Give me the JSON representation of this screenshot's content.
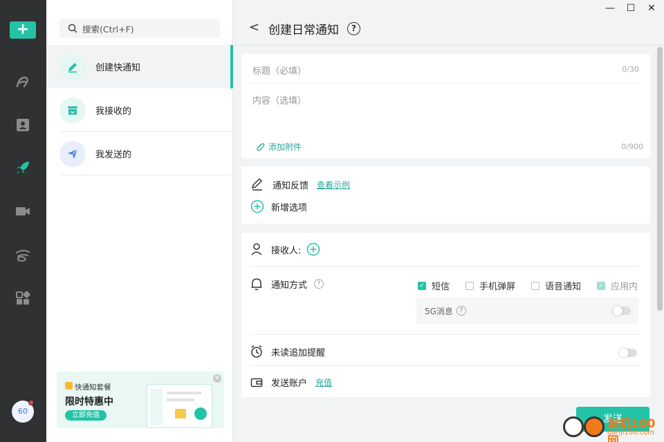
{
  "rail": {
    "new_label": "+",
    "icons": [
      "logo-a-icon",
      "contacts-icon",
      "rocket-icon",
      "video-icon",
      "cloud-icon",
      "apps-icon"
    ],
    "avatar": "60"
  },
  "search": {
    "placeholder": "搜索(Ctrl+F)"
  },
  "nav": [
    {
      "label": "创建快通知"
    },
    {
      "label": "我接收的"
    },
    {
      "label": "我发送的"
    }
  ],
  "promo": {
    "tag": "快通知套餐",
    "headline": "限时特惠中",
    "button": "立即充值"
  },
  "header": {
    "back": "<",
    "title": "创建日常通知",
    "help": "?"
  },
  "window": {
    "minimize": "—",
    "maximize": "☐",
    "close": "✕"
  },
  "form": {
    "title_placeholder": "标题（必填）",
    "title_count": "0/30",
    "content_placeholder": "内容（选填）",
    "content_count": "0/900",
    "attach_label": "添加附件"
  },
  "feedback": {
    "label": "通知反馈",
    "example_link": "查看示例",
    "add_option": "新增选项"
  },
  "recipients": {
    "label": "接收人:"
  },
  "method": {
    "label": "通知方式",
    "options": [
      {
        "label": "短信",
        "checked": true
      },
      {
        "label": "手机弹屏",
        "checked": false
      },
      {
        "label": "语音通知",
        "checked": false
      },
      {
        "label": "应用内",
        "checked": true
      }
    ],
    "sub_label": "5G消息"
  },
  "reminder": {
    "label": "未读追加提醒"
  },
  "account": {
    "label": "发送账户",
    "recharge_link": "充值"
  },
  "send_button": "发送",
  "watermark": {
    "title": "单机100网",
    "url": "danji100.com"
  },
  "colors": {
    "accent": "#23c3a6",
    "rail": "#2f3132",
    "link": "#23a99a"
  }
}
